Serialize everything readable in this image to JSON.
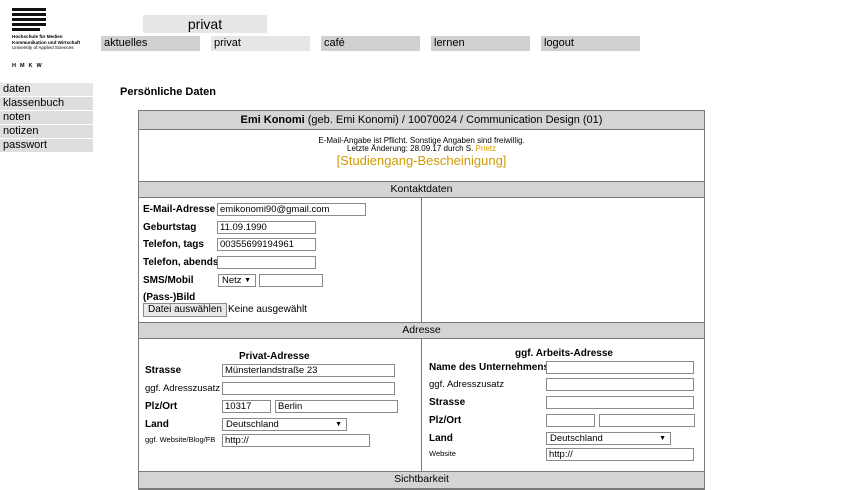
{
  "logo": {
    "line1": "Hochschule für Medien",
    "line2": "Kommunikation und Wirtschaft",
    "line3": "University of Applied Sciences",
    "abbr": "HMKW"
  },
  "section_title": "privat",
  "nav": [
    {
      "label": "aktuelles"
    },
    {
      "label": "privat"
    },
    {
      "label": "café"
    },
    {
      "label": "lernen"
    },
    {
      "label": "logout"
    }
  ],
  "sidebar": [
    {
      "label": "daten"
    },
    {
      "label": "klassenbuch"
    },
    {
      "label": "noten"
    },
    {
      "label": "notizen"
    },
    {
      "label": "passwort"
    }
  ],
  "page_heading": "Persönliche Daten",
  "student": {
    "name": "Emi Konomi",
    "rest": " (geb. Emi Konomi)  / 10070024  / Communication Design (01)"
  },
  "notice": {
    "line1": "E-Mail-Angabe ist Pflicht. Sonstige Angaben sind freiwillig.",
    "line2_prefix": "Letzte Änderung: 28.09.17 durch S.",
    "line2_name": "Prietz"
  },
  "certificate_link": "[Studiengang-Bescheinigung]",
  "sections": {
    "contact": "Kontaktdaten",
    "address": "Adresse",
    "visibility": "Sichtbarkeit"
  },
  "contact": {
    "email_label": "E-Mail-Adresse",
    "email_value": "emikonomi90@gmail.com",
    "birthday_label": "Geburtstag",
    "birthday_value": "11.09.1990",
    "phone_day_label": "Telefon, tags",
    "phone_day_value": "00355699194961",
    "phone_evening_label": "Telefon, abends",
    "phone_evening_value": "",
    "sms_label": "SMS/Mobil",
    "sms_network": "Netz",
    "sms_value": "",
    "photo_label": "(Pass-)Bild",
    "file_button": "Datei auswählen",
    "file_status": "Keine ausgewählt"
  },
  "private_address": {
    "heading": "Privat-Adresse",
    "street_label": "Strasse",
    "street_value": "Münsterlandstraße 23",
    "extra_label": "ggf. Adresszusatz",
    "extra_value": "",
    "zip_city_label": "Plz/Ort",
    "zip_value": "10317",
    "city_value": "Berlin",
    "country_label": "Land",
    "country_value": "Deutschland",
    "website_label": "ggf. Website/Blog/FB",
    "website_value": "http://"
  },
  "work_address": {
    "heading": "ggf. Arbeits-Adresse",
    "company_label": "Name des Unternehmens",
    "company_value": "",
    "extra_label": "ggf. Adresszusatz",
    "extra_value": "",
    "street_label": "Strasse",
    "street_value": "",
    "zip_city_label": "Plz/Ort",
    "zip_value": "",
    "city_value": "",
    "country_label": "Land",
    "country_value": "Deutschland",
    "website_label": "Website",
    "website_value": "http://"
  },
  "icons": {
    "dropdown": "chevron-down-icon"
  }
}
